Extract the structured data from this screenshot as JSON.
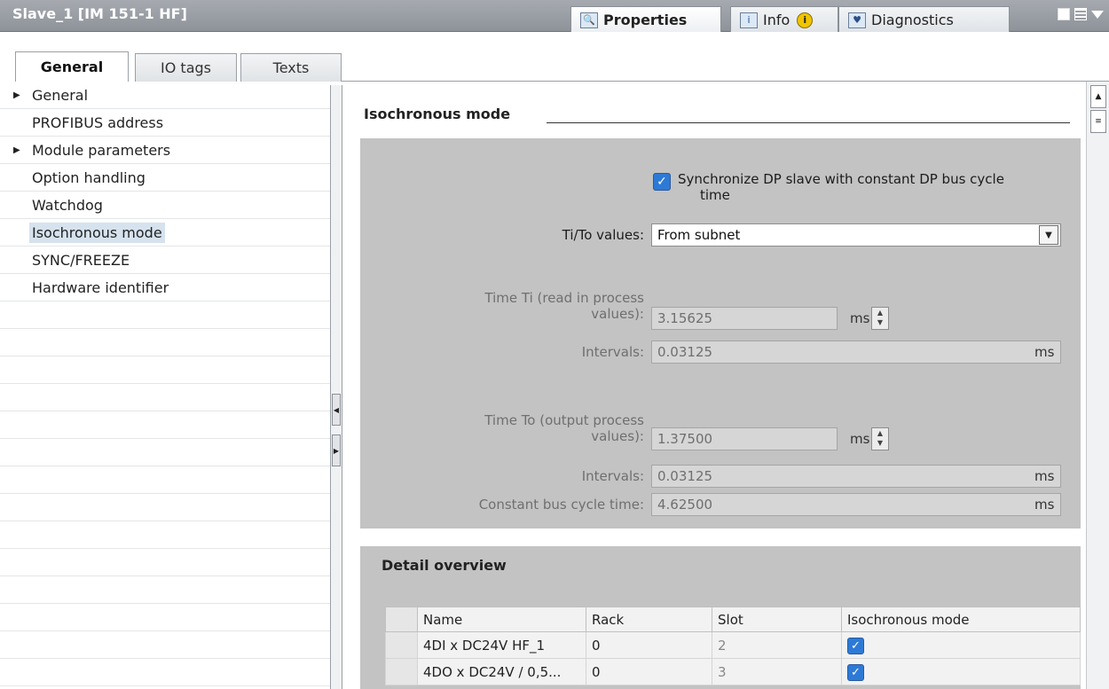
{
  "window": {
    "title": "Slave_1 [IM 151-1 HF]"
  },
  "panel_tabs": [
    {
      "label": "Properties",
      "icon": "properties-icon"
    },
    {
      "label": "Info",
      "icon": "info-icon"
    },
    {
      "label": "Diagnostics",
      "icon": "diagnostics-icon"
    }
  ],
  "main_tabs": [
    {
      "label": "General"
    },
    {
      "label": "IO tags"
    },
    {
      "label": "Texts"
    }
  ],
  "nav": {
    "items": [
      {
        "label": "General",
        "expandable": true
      },
      {
        "label": "PROFIBUS address",
        "expandable": false
      },
      {
        "label": "Module parameters",
        "expandable": true
      },
      {
        "label": "Option handling",
        "expandable": false
      },
      {
        "label": "Watchdog",
        "expandable": false
      },
      {
        "label": "Isochronous mode",
        "expandable": false,
        "selected": true
      },
      {
        "label": "SYNC/FREEZE",
        "expandable": false
      },
      {
        "label": "Hardware identifier",
        "expandable": false
      }
    ]
  },
  "iso": {
    "section_title": "Isochronous mode",
    "sync_checkbox_label_1": "Synchronize DP slave with constant DP bus cycle",
    "sync_checkbox_label_2": "time",
    "sync_checked": true,
    "tito_label": "Ti/To values:",
    "tito_value": "From subnet",
    "ti_label_1": "Time Ti (read in process",
    "ti_label_2": "values):",
    "ti_value": "3.15625",
    "ti_unit": "ms",
    "ti_intervals_label": "Intervals:",
    "ti_intervals_value": "0.03125",
    "ti_intervals_unit": "ms",
    "to_label_1": "Time To (output process",
    "to_label_2": "values):",
    "to_value": "1.37500",
    "to_unit": "ms",
    "to_intervals_label": "Intervals:",
    "to_intervals_value": "0.03125",
    "to_intervals_unit": "ms",
    "cycle_label": "Constant bus cycle time:",
    "cycle_value": "4.62500",
    "cycle_unit": "ms"
  },
  "detail": {
    "title": "Detail overview",
    "columns": [
      "Name",
      "Rack",
      "Slot",
      "Isochronous mode"
    ],
    "rows": [
      {
        "name": "4DI x DC24V HF_1",
        "rack": "0",
        "slot": "2",
        "iso": true
      },
      {
        "name": "4DO x DC24V / 0,5...",
        "rack": "0",
        "slot": "3",
        "iso": true
      }
    ]
  },
  "colors": {
    "accent": "#2d7ad6",
    "panel_gray": "#c3c3c3",
    "titlebar": "#9a9ea4"
  }
}
